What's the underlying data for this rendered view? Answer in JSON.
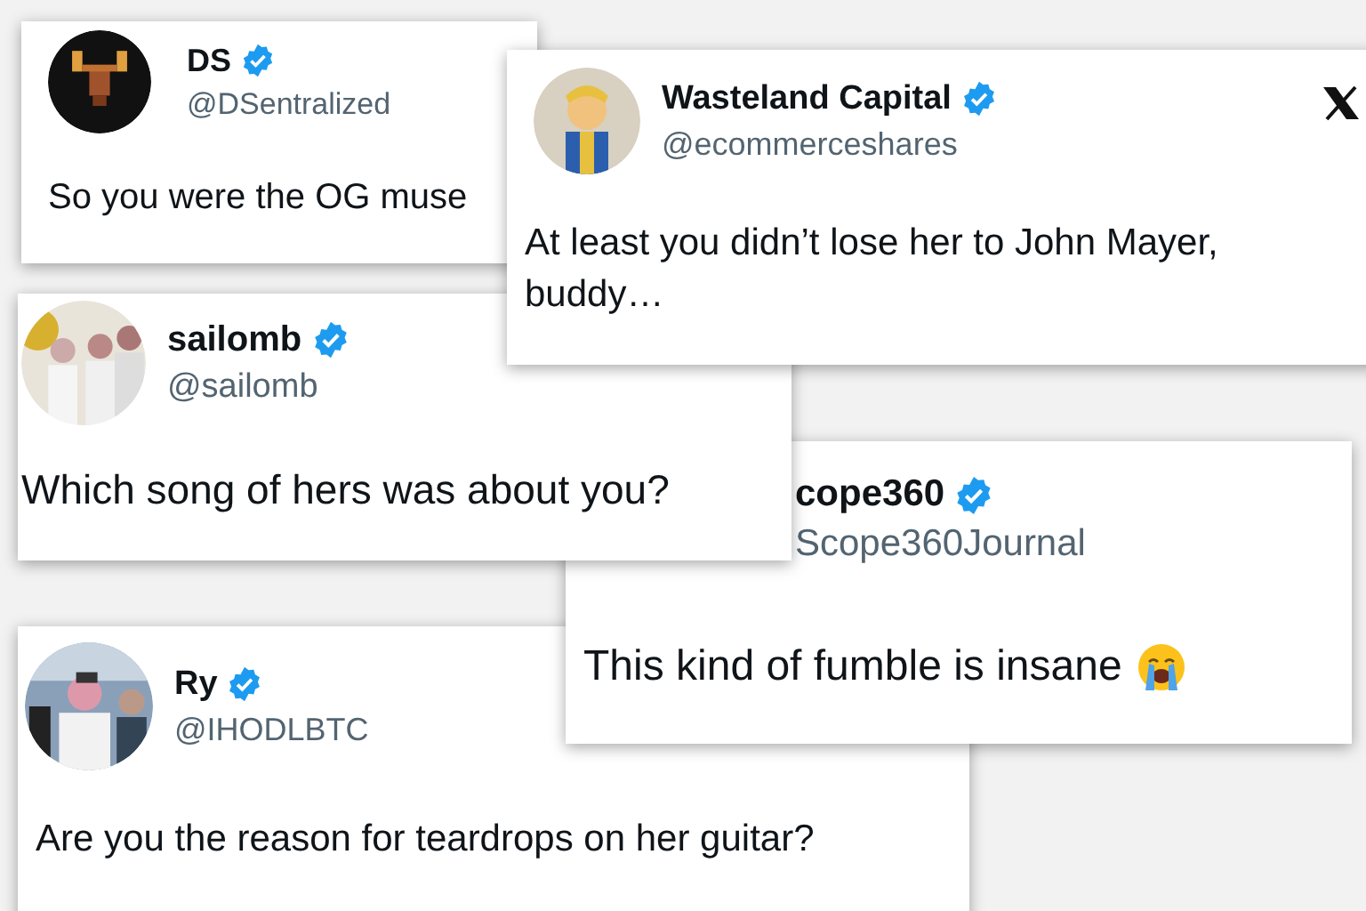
{
  "tweets": [
    {
      "name": "DS",
      "verified": true,
      "handle": "@DSentralized",
      "text": "So you were the OG muse"
    },
    {
      "name": "Wasteland Capital",
      "verified": true,
      "handle": "@ecommerceshares",
      "text": "At least you didn’t lose her to John Mayer, buddy…"
    },
    {
      "name": "sailomb",
      "verified": true,
      "handle": "@sailomb",
      "text": "Which song of hers was about you?"
    },
    {
      "name": "cope360",
      "verified": true,
      "handle": "Scope360Journal",
      "text": "This kind of fumble is insane"
    },
    {
      "name": "Ry",
      "verified": true,
      "handle": "@IHODLBTC",
      "text": "Are you the reason for teardrops on her guitar?"
    }
  ]
}
